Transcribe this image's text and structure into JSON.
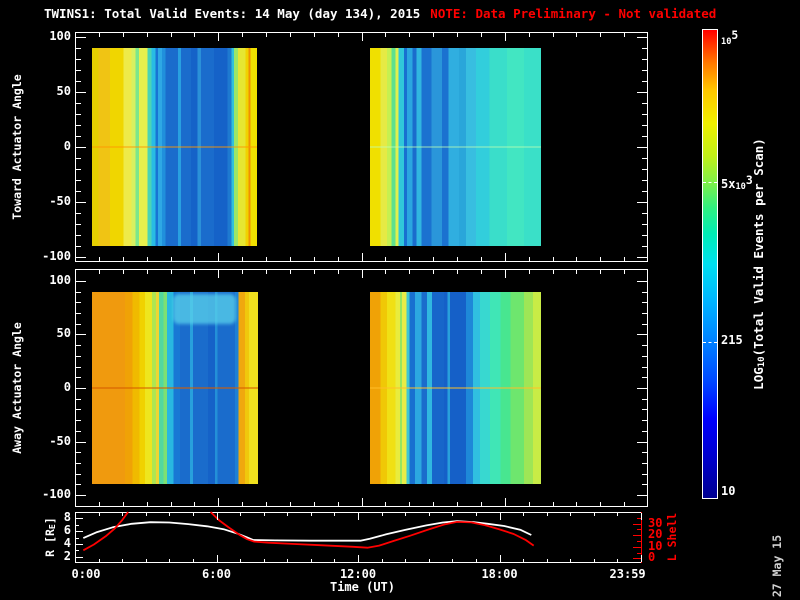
{
  "title": {
    "main": "TWINS1: Total Valid Events: 14 May (day 134), 2015",
    "note": "NOTE: Data Preliminary - Not validated"
  },
  "colors": {
    "background": "#000000",
    "axis": "#ffffff",
    "note_red": "#ff0000",
    "lshell_red": "#ff0000",
    "r_curve": "#ffffff",
    "date_gray": "#d0d0d0"
  },
  "date_stamp": "27 May 15",
  "time_axis": {
    "label": "Time (UT)",
    "range_hours": [
      0,
      24
    ],
    "minor_step_hours": 1,
    "major_ticks": [
      {
        "hours": 0,
        "label": "0:00"
      },
      {
        "hours": 6,
        "label": "6:00"
      },
      {
        "hours": 12,
        "label": "12:00"
      },
      {
        "hours": 18,
        "label": "18:00"
      },
      {
        "hours": 23.983,
        "label": "23:59"
      }
    ]
  },
  "angle_axes": {
    "toward_label": "Toward Actuator Angle",
    "away_label": "Away Actuator Angle",
    "ticks": [
      100,
      50,
      0,
      -50,
      -100
    ],
    "minor_step": 10
  },
  "orbit_axes": {
    "left_label": "R [RE]",
    "left_label_parts": [
      {
        "t": "R [R"
      },
      {
        "small": "E"
      },
      {
        "t": "]"
      }
    ],
    "left_ticks": [
      8,
      6,
      4,
      2
    ],
    "left_minor_ticks": [
      3,
      5,
      7
    ],
    "left_range": [
      1,
      9
    ],
    "right_label": "L Shell",
    "right_ticks": [
      30,
      20,
      10,
      0
    ],
    "right_minor_ticks": [
      5,
      15,
      25,
      35
    ],
    "right_range": [
      -4,
      40
    ]
  },
  "colorbar": {
    "title": "LOG10(Total Valid Events per Scan)",
    "title_parts": [
      {
        "t": "LOG"
      },
      {
        "small": "10"
      },
      {
        "t": "(Total Valid Events per Scan)"
      }
    ],
    "labels": [
      {
        "text": "10^5",
        "frac": 1.0,
        "dash": false,
        "parts": [
          {
            "small": "10"
          },
          {
            "sup": "5"
          }
        ]
      },
      {
        "text": "5x10^3",
        "frac": 0.675,
        "dash": true,
        "parts": [
          {
            "t": "5x"
          },
          {
            "small": "10"
          },
          {
            "sup": "3"
          }
        ]
      },
      {
        "text": "215",
        "frac": 0.333,
        "dash": true,
        "parts": [
          {
            "t": "215"
          }
        ]
      },
      {
        "text": "10",
        "frac": 0.0,
        "dash": false,
        "parts": [
          {
            "t": "10"
          }
        ]
      }
    ],
    "gradient": [
      [
        0.0,
        "#000090"
      ],
      [
        0.08,
        "#0000c8"
      ],
      [
        0.17,
        "#0000ff"
      ],
      [
        0.25,
        "#0048ff"
      ],
      [
        0.333,
        "#0080ff"
      ],
      [
        0.42,
        "#00b4ff"
      ],
      [
        0.5,
        "#00e0f0"
      ],
      [
        0.565,
        "#00eeb4"
      ],
      [
        0.62,
        "#30f080"
      ],
      [
        0.675,
        "#80f048"
      ],
      [
        0.73,
        "#c0f018"
      ],
      [
        0.8,
        "#f0f000"
      ],
      [
        0.87,
        "#ffc800"
      ],
      [
        0.93,
        "#ff7800"
      ],
      [
        1.0,
        "#ff0000"
      ]
    ]
  },
  "chart_data": [
    {
      "type": "heatmap",
      "panel": "toward",
      "axis_label": "Toward Actuator Angle",
      "x_unit": "hours UT",
      "y_unit": "degrees",
      "y_range": [
        -105,
        105
      ],
      "value_scale": "LOG10(Total Valid Events per Scan)",
      "blocks": [
        {
          "t_hours": [
            0.71,
            7.62
          ],
          "angle_span": [
            -90,
            90
          ],
          "zero_line": "rgba(255,150,0,0.45)",
          "stripes": [
            [
              0.0,
              "#e6cf00"
            ],
            [
              0.04,
              "#f0c414"
            ],
            [
              0.11,
              "#f0d600"
            ],
            [
              0.19,
              "#eeea4a"
            ],
            [
              0.24,
              "#d8f060"
            ],
            [
              0.265,
              "#7ce68c"
            ],
            [
              0.285,
              "#e8f04c"
            ],
            [
              0.335,
              "#4cd4b4"
            ],
            [
              0.36,
              "#28bce4"
            ],
            [
              0.385,
              "#1874d4"
            ],
            [
              0.4,
              "#2ea8e4"
            ],
            [
              0.425,
              "#2090dc"
            ],
            [
              0.445,
              "#1a6ccc"
            ],
            [
              0.52,
              "#28a0e0"
            ],
            [
              0.54,
              "#1a6ccc"
            ],
            [
              0.6,
              "#1562c8"
            ],
            [
              0.64,
              "#2a90d8"
            ],
            [
              0.66,
              "#1a6ccc"
            ],
            [
              0.74,
              "#1562c8"
            ],
            [
              0.82,
              "#1e7ad0"
            ],
            [
              0.845,
              "#30c0dc"
            ],
            [
              0.86,
              "#9ce668"
            ],
            [
              0.885,
              "#e6e632"
            ],
            [
              0.93,
              "#f0d200"
            ],
            [
              0.948,
              "#f09000"
            ],
            [
              0.962,
              "#f0e000"
            ]
          ]
        },
        {
          "t_hours": [
            12.36,
            19.52
          ],
          "angle_span": [
            -90,
            90
          ],
          "zero_line": "rgba(190,255,180,0.4)",
          "stripes": [
            [
              0.0,
              "#f0e000"
            ],
            [
              0.06,
              "#e6ea44"
            ],
            [
              0.1,
              "#c6f050"
            ],
            [
              0.125,
              "#5ee08e"
            ],
            [
              0.148,
              "#dff04e"
            ],
            [
              0.168,
              "#30c8da"
            ],
            [
              0.198,
              "#1870d0"
            ],
            [
              0.215,
              "#2aa6e0"
            ],
            [
              0.25,
              "#1a6ccc"
            ],
            [
              0.272,
              "#30b6e0"
            ],
            [
              0.3,
              "#1b72d0"
            ],
            [
              0.36,
              "#2a96da"
            ],
            [
              0.42,
              "#1b72d0"
            ],
            [
              0.46,
              "#30aee0"
            ],
            [
              0.52,
              "#2aa6da"
            ],
            [
              0.56,
              "#38bee0"
            ],
            [
              0.62,
              "#32cedc"
            ],
            [
              0.7,
              "#3adeca"
            ],
            [
              0.8,
              "#42e6c2"
            ],
            [
              0.9,
              "#3ae0c8"
            ]
          ]
        }
      ]
    },
    {
      "type": "heatmap",
      "panel": "away",
      "axis_label": "Away Actuator Angle",
      "x_unit": "hours UT",
      "y_unit": "degrees",
      "y_range": [
        -111,
        111
      ],
      "value_scale": "LOG10(Total Valid Events per Scan)",
      "blocks": [
        {
          "t_hours": [
            0.71,
            7.66
          ],
          "angle_span": [
            -90,
            90
          ],
          "zero_line": "rgba(215,95,0,0.55)",
          "feature": {
            "t_frac": [
              0.49,
              0.87
            ],
            "angle_top": 88,
            "angle_bottom": 60,
            "color": "rgba(90,210,235,0.75)"
          },
          "stripes": [
            [
              0.0,
              "#f09a0e"
            ],
            [
              0.2,
              "#f0a206"
            ],
            [
              0.245,
              "#f0ba00"
            ],
            [
              0.285,
              "#f0d200"
            ],
            [
              0.32,
              "#eee61e"
            ],
            [
              0.36,
              "#aee652"
            ],
            [
              0.385,
              "#eed632"
            ],
            [
              0.405,
              "#52d8a0"
            ],
            [
              0.43,
              "#7ee072"
            ],
            [
              0.452,
              "#28b8e0"
            ],
            [
              0.49,
              "#1878d4"
            ],
            [
              0.53,
              "#1a6ccc"
            ],
            [
              0.59,
              "#28a0dc"
            ],
            [
              0.607,
              "#1a6ccc"
            ],
            [
              0.7,
              "#1562c8"
            ],
            [
              0.74,
              "#2390d8"
            ],
            [
              0.757,
              "#1a6ccc"
            ],
            [
              0.862,
              "#1e80d4"
            ],
            [
              0.882,
              "#f0a80e"
            ],
            [
              0.922,
              "#f0c80c"
            ],
            [
              0.947,
              "#f0e01e"
            ]
          ]
        },
        {
          "t_hours": [
            12.36,
            19.52
          ],
          "angle_span": [
            -90,
            90
          ],
          "zero_line": "rgba(255,190,40,0.5)",
          "stripes": [
            [
              0.0,
              "#f0a206"
            ],
            [
              0.06,
              "#f0c806"
            ],
            [
              0.1,
              "#f0e014"
            ],
            [
              0.15,
              "#e8ec3e"
            ],
            [
              0.176,
              "#96e65e"
            ],
            [
              0.188,
              "#e8ec46"
            ],
            [
              0.212,
              "#3ec8d0"
            ],
            [
              0.232,
              "#1870d0"
            ],
            [
              0.262,
              "#2ca8e0"
            ],
            [
              0.3,
              "#1a6ccc"
            ],
            [
              0.332,
              "#30b8e0"
            ],
            [
              0.362,
              "#1766ca"
            ],
            [
              0.432,
              "#1560c8"
            ],
            [
              0.452,
              "#28a0dc"
            ],
            [
              0.468,
              "#1560c8"
            ],
            [
              0.562,
              "#1e88d8"
            ],
            [
              0.602,
              "#30c0e0"
            ],
            [
              0.642,
              "#38d8d0"
            ],
            [
              0.702,
              "#40e6b6"
            ],
            [
              0.762,
              "#48e690"
            ],
            [
              0.822,
              "#6ee66e"
            ],
            [
              0.902,
              "#9ee656"
            ],
            [
              0.952,
              "#c8ec46"
            ]
          ]
        }
      ]
    },
    {
      "type": "line",
      "panel": "orbit",
      "x_unit": "hours UT",
      "series": [
        {
          "name": "R [RE]",
          "axis": "left",
          "color": "#ffffff",
          "points": [
            [
              0.35,
              4.9
            ],
            [
              0.9,
              5.8
            ],
            [
              1.6,
              6.6
            ],
            [
              2.4,
              7.15
            ],
            [
              3.2,
              7.4
            ],
            [
              4.0,
              7.35
            ],
            [
              4.8,
              7.1
            ],
            [
              5.6,
              6.75
            ],
            [
              6.3,
              6.3
            ],
            [
              6.9,
              5.6
            ],
            [
              7.3,
              5.0
            ],
            [
              7.55,
              4.6
            ],
            [
              8.5,
              4.55
            ],
            [
              10.0,
              4.5
            ],
            [
              11.5,
              4.5
            ],
            [
              12.1,
              4.5
            ],
            [
              12.5,
              4.8
            ],
            [
              13.2,
              5.5
            ],
            [
              14.0,
              6.2
            ],
            [
              14.9,
              6.9
            ],
            [
              15.6,
              7.35
            ],
            [
              16.2,
              7.55
            ],
            [
              16.9,
              7.4
            ],
            [
              17.5,
              7.15
            ],
            [
              18.2,
              6.8
            ],
            [
              18.9,
              6.2
            ],
            [
              19.35,
              5.4
            ]
          ]
        },
        {
          "name": "L Shell",
          "axis": "right",
          "color": "#ff0000",
          "segments": [
            [
              [
                0.35,
                7
              ],
              [
                0.8,
                12
              ],
              [
                1.3,
                19
              ],
              [
                1.7,
                26
              ],
              [
                2.0,
                33
              ],
              [
                2.25,
                40
              ]
            ],
            [
              [
                5.75,
                40
              ],
              [
                6.1,
                33
              ],
              [
                6.5,
                27
              ],
              [
                7.0,
                20
              ],
              [
                7.3,
                16.5
              ],
              [
                7.6,
                14.5
              ],
              [
                8.2,
                13.5
              ],
              [
                9.2,
                12.5
              ],
              [
                10.5,
                11.3
              ],
              [
                11.8,
                10.0
              ],
              [
                12.4,
                9.2
              ],
              [
                12.9,
                11
              ],
              [
                13.5,
                15
              ],
              [
                14.2,
                19.5
              ],
              [
                15.0,
                25
              ],
              [
                15.7,
                29.5
              ],
              [
                16.2,
                31.5
              ],
              [
                16.8,
                31
              ],
              [
                17.4,
                28.5
              ],
              [
                18.0,
                25
              ],
              [
                18.6,
                21
              ],
              [
                19.1,
                16
              ],
              [
                19.45,
                11
              ]
            ]
          ]
        }
      ]
    }
  ]
}
